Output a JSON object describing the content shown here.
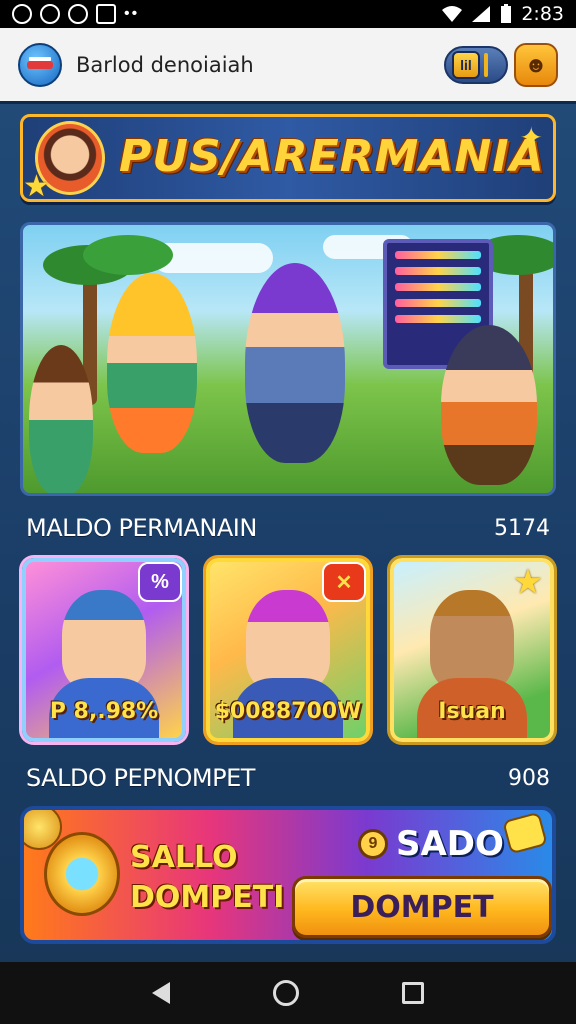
{
  "status_bar": {
    "time": "2:83",
    "left_icons": [
      "sync-icon",
      "circle-icon",
      "clock-icon",
      "image-icon"
    ],
    "right_icons": [
      "wifi-icon",
      "signal-icon",
      "battery-icon"
    ]
  },
  "header": {
    "title": "Barlod denoiaiah",
    "badge_label": "lil"
  },
  "banner": {
    "title": "PUS/ARERMANIA"
  },
  "section1": {
    "label": "MALDO PERMANAIN",
    "value": "5174"
  },
  "cards": [
    {
      "price": "P 8,.98%",
      "badge": "%",
      "badge_color": "#7a3ad0"
    },
    {
      "price": "$0088700W",
      "badge": "✕",
      "badge_color": "#e83a1a"
    },
    {
      "price": "Isuan",
      "badge": "★",
      "badge_color": "#ffd93a"
    }
  ],
  "section2": {
    "label": "SALDO PEPNOMPET",
    "value": "908"
  },
  "wallet": {
    "line1": "SALLO",
    "line2": "DOMPETI",
    "saldo_icon_text": "9",
    "saldo_label": "SADO",
    "button_label": "DOMPET"
  },
  "colors": {
    "background": "#1b3c63",
    "accent": "#ffd33a",
    "button": "#ffb81e"
  }
}
